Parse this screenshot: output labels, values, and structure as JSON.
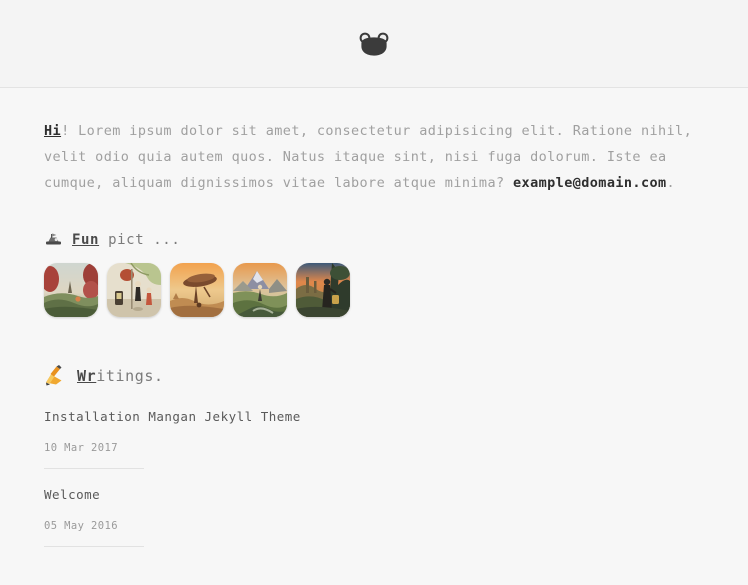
{
  "site": {
    "background_color": "#f7f7f7",
    "header_background": "#f4f4f4",
    "header_border": "#e3e3e3",
    "accent_text_color": "#2f2f2f",
    "body_text_color": "#a0a0a0"
  },
  "header": {
    "logo_name": "frog-head-logo",
    "logo_color": "#3b3b3b",
    "logo_eye_color": "#efefef"
  },
  "intro": {
    "greeting": "Hi",
    "greeting_punct": "!",
    "body": " Lorem ipsum dolor sit amet, consectetur adipisicing elit. Ratione nihil, velit odio quia autem quos. Natus itaque sint, nisi fuga dolorum. Iste ea cumque, aliquam dignissimos vitae labore atque minima? ",
    "email": "example@domain.com",
    "trailing_punct": "."
  },
  "pictures_section": {
    "emoji_name": "camera-emoji",
    "label_underlined": "Fun",
    "label_rest": " pict ...",
    "thumbnails": [
      {
        "name": "thumbnail-1",
        "alt": "pastel landscape with red trees and distant spire"
      },
      {
        "name": "thumbnail-2",
        "alt": "two figures beneath a tree beside a lamp post"
      },
      {
        "name": "thumbnail-3",
        "alt": "orange sky over desert rock formation"
      },
      {
        "name": "thumbnail-4",
        "alt": "mountain valley at sunset with river"
      },
      {
        "name": "thumbnail-5",
        "alt": "lone traveller on a path at dusk"
      }
    ]
  },
  "writings_section": {
    "emoji_name": "writing-hand-emoji",
    "label_underlined": "Wr",
    "label_rest": "itings.",
    "posts": [
      {
        "title": "Installation Mangan Jekyll Theme",
        "date": "10 Mar 2017"
      },
      {
        "title": "Welcome",
        "date": "05 May 2016"
      }
    ]
  }
}
